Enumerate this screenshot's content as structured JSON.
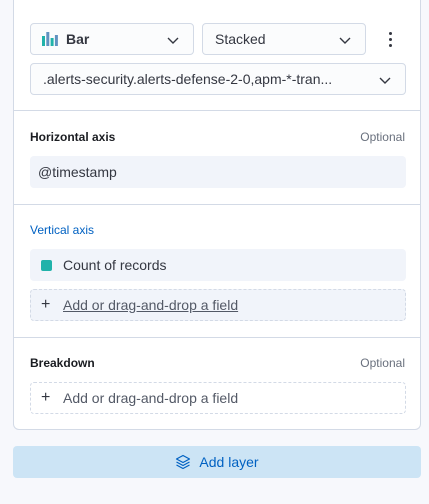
{
  "toolbar": {
    "chart_type_label": "Bar",
    "chart_type_icon": "bar-chart-icon",
    "mode_label": "Stacked",
    "index_pattern": ".alerts-security.alerts-defense-2-0,apm-*-tran..."
  },
  "horizontal_axis": {
    "title": "Horizontal axis",
    "optional": "Optional",
    "field": "@timestamp"
  },
  "vertical_axis": {
    "title": "Vertical axis",
    "field": "Count of records",
    "field_color": "#20b2aa",
    "add_field": "Add or drag-and-drop a field"
  },
  "breakdown": {
    "title": "Breakdown",
    "optional": "Optional",
    "add_field": "Add or drag-and-drop a field"
  },
  "footer": {
    "add_layer_label": "Add layer"
  },
  "colors": {
    "accent": "#0061c2",
    "accent_bg": "#cce4f5"
  }
}
